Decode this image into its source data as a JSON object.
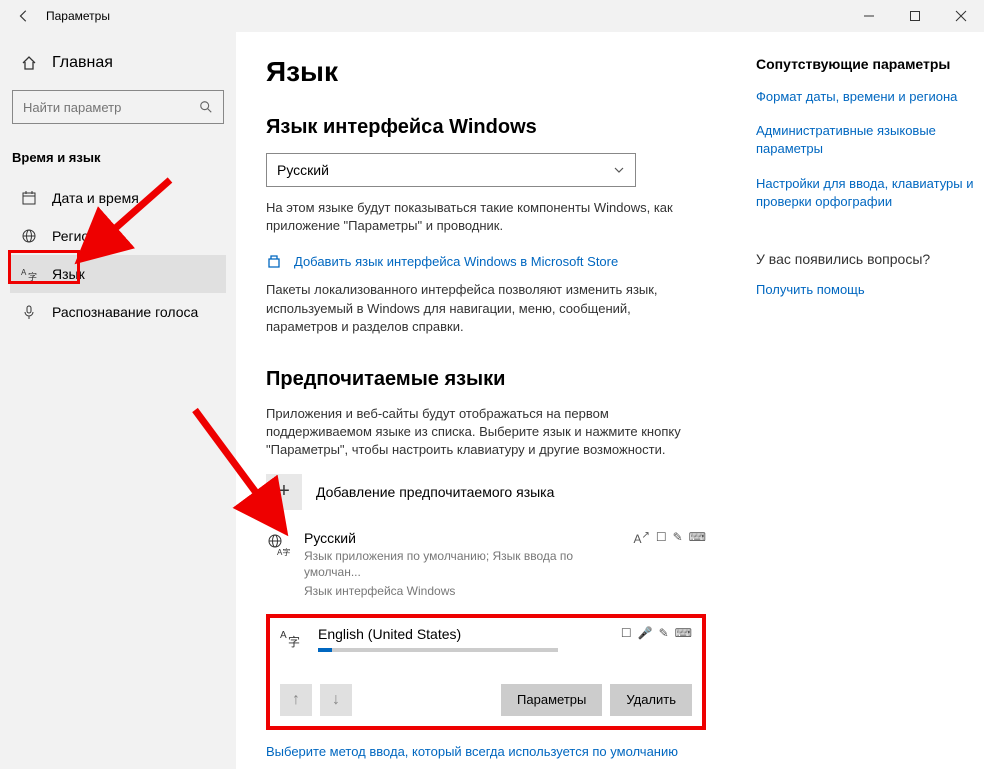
{
  "titlebar": {
    "title": "Параметры"
  },
  "sidebar": {
    "home": "Главная",
    "search_placeholder": "Найти параметр",
    "category": "Время и язык",
    "items": [
      {
        "label": "Дата и время"
      },
      {
        "label": "Регион"
      },
      {
        "label": "Язык"
      },
      {
        "label": "Распознавание голоса"
      }
    ]
  },
  "main": {
    "title": "Язык",
    "display_lang_heading": "Язык интерфейса Windows",
    "display_lang_value": "Русский",
    "display_lang_desc": "На этом языке будут показываться такие компоненты Windows, как приложение \"Параметры\" и проводник.",
    "store_link": "Добавить язык интерфейса Windows в Microsoft Store",
    "lip_desc": "Пакеты локализованного интерфейса позволяют изменить язык, используемый в Windows для навигации, меню, сообщений, параметров и разделов справки.",
    "pref_heading": "Предпочитаемые языки",
    "pref_desc": "Приложения и веб-сайты будут отображаться на первом поддерживаемом языке из списка. Выберите язык и нажмите кнопку \"Параметры\", чтобы настроить клавиатуру и другие возможности.",
    "add_label": "Добавление предпочитаемого языка",
    "languages": [
      {
        "name": "Русский",
        "sub1": "Язык приложения по умолчанию; Язык ввода по умолчан...",
        "sub2": "Язык интерфейса Windows"
      },
      {
        "name": "English (United States)"
      }
    ],
    "options_btn": "Параметры",
    "delete_btn": "Удалить",
    "bottom_link": "Выберите метод ввода, который всегда используется по умолчанию"
  },
  "related": {
    "heading": "Сопутствующие параметры",
    "links": [
      "Формат даты, времени и региона",
      "Административные языковые параметры",
      "Настройки для ввода, клавиатуры и проверки орфографии"
    ],
    "question": "У вас появились вопросы?",
    "help_link": "Получить помощь"
  }
}
